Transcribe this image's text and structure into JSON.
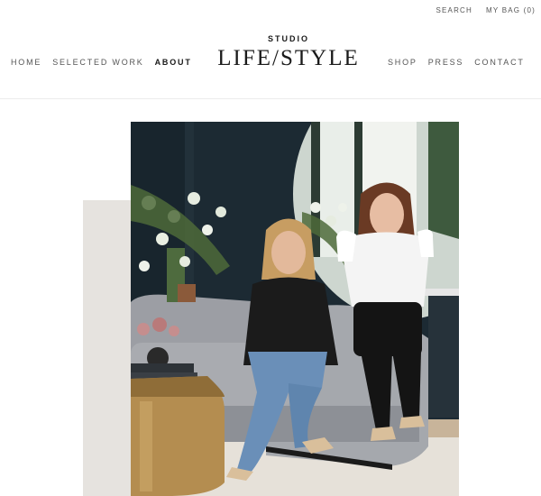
{
  "utility": {
    "search": "SEARCH",
    "bag": "MY BAG (0)"
  },
  "nav": {
    "left": [
      "HOME",
      "SELECTED WORK",
      "ABOUT"
    ],
    "right": [
      "SHOP",
      "PRESS",
      "CONTACT"
    ],
    "active": "ABOUT"
  },
  "logo": {
    "top": "STUDIO",
    "main": "LIFE/STYLE"
  },
  "colors": {
    "accent_block": "#e6e3df",
    "wall": "#1c2a33",
    "sofa": "#a9abb0",
    "text": "#2a2a2a"
  },
  "hero": {
    "image": "two women seated on a grey velvet sofa in a dark navy room"
  }
}
